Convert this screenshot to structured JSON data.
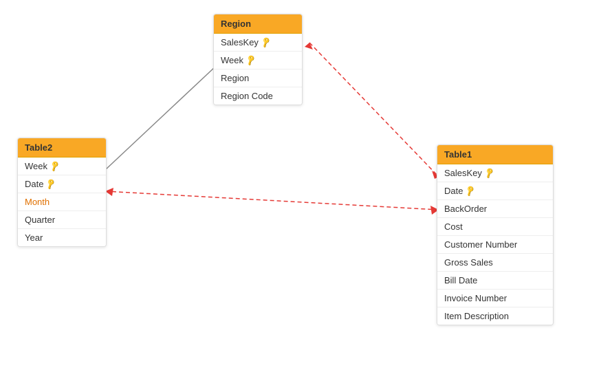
{
  "tables": {
    "region": {
      "title": "Region",
      "fields": [
        {
          "name": "SalesKey",
          "key": true,
          "link": false
        },
        {
          "name": "Week",
          "key": true,
          "link": false
        },
        {
          "name": "Region",
          "key": false,
          "link": false
        },
        {
          "name": "Region Code",
          "key": false,
          "link": false
        }
      ]
    },
    "table2": {
      "title": "Table2",
      "fields": [
        {
          "name": "Week",
          "key": true,
          "link": false
        },
        {
          "name": "Date",
          "key": true,
          "link": false
        },
        {
          "name": "Month",
          "key": false,
          "link": true
        },
        {
          "name": "Quarter",
          "key": false,
          "link": false
        },
        {
          "name": "Year",
          "key": false,
          "link": false
        }
      ]
    },
    "table1": {
      "title": "Table1",
      "fields": [
        {
          "name": "SalesKey",
          "key": true,
          "link": false
        },
        {
          "name": "Date",
          "key": true,
          "link": false
        },
        {
          "name": "BackOrder",
          "key": false,
          "link": false
        },
        {
          "name": "Cost",
          "key": false,
          "link": false
        },
        {
          "name": "Customer Number",
          "key": false,
          "link": false
        },
        {
          "name": "Gross Sales",
          "key": false,
          "link": false
        },
        {
          "name": "Bill Date",
          "key": false,
          "link": false
        },
        {
          "name": "Invoice Number",
          "key": false,
          "link": false
        },
        {
          "name": "Item Description",
          "key": false,
          "link": false
        }
      ]
    }
  }
}
